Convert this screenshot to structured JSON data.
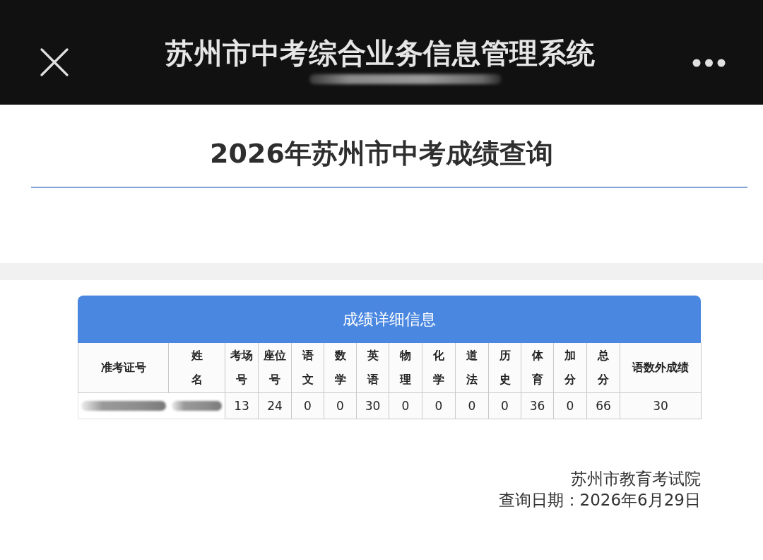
{
  "top_bar": {
    "title": "苏州市中考综合业务信息管理系统",
    "subtitle_redacted": true
  },
  "page_title": "2026年苏州市中考成绩查询",
  "score_table": {
    "caption": "成绩详细信息",
    "columns": [
      "准考证号",
      "姓名",
      "考场号",
      "座位号",
      "语文",
      "数学",
      "英语",
      "物理",
      "化学",
      "道法",
      "历史",
      "体育",
      "加分",
      "总分",
      "语数外成绩"
    ],
    "rows": [
      {
        "cells": [
          {
            "kind": "redacted"
          },
          {
            "kind": "redacted"
          },
          {
            "kind": "text",
            "text": "13"
          },
          {
            "kind": "text",
            "text": "24"
          },
          {
            "kind": "text",
            "text": "0"
          },
          {
            "kind": "text",
            "text": "0"
          },
          {
            "kind": "text",
            "text": "30"
          },
          {
            "kind": "text",
            "text": "0"
          },
          {
            "kind": "text",
            "text": "0"
          },
          {
            "kind": "text",
            "text": "0"
          },
          {
            "kind": "text",
            "text": "0"
          },
          {
            "kind": "text",
            "text": "36"
          },
          {
            "kind": "text",
            "text": "0"
          },
          {
            "kind": "text",
            "text": "66"
          },
          {
            "kind": "text",
            "text": "30"
          }
        ]
      }
    ]
  },
  "footer": {
    "issuer": "苏州市教育考试院",
    "query_date": "查询日期：2026年6月29日"
  }
}
